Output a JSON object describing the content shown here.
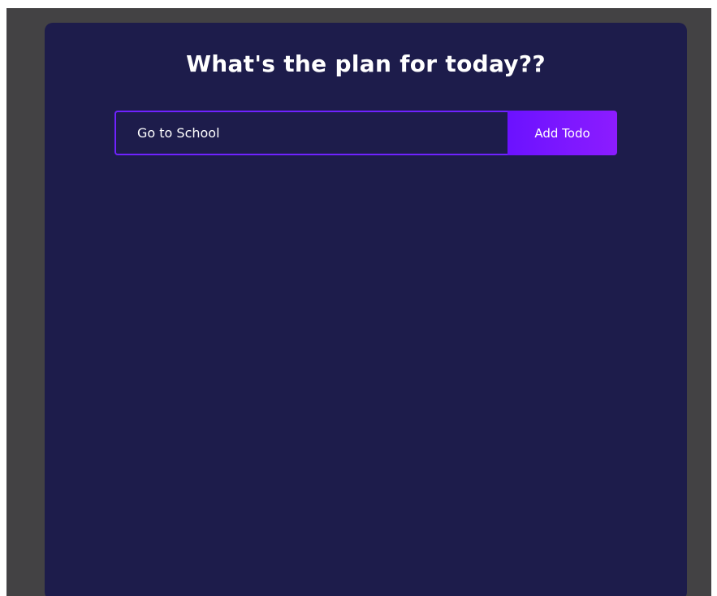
{
  "app": {
    "title": "What's the plan for today??"
  },
  "form": {
    "input_value": "Go to School",
    "button_label": "Add Todo"
  },
  "colors": {
    "outer_background": "#434244",
    "panel_background": "#1d1c4b",
    "accent": "#6f22ff",
    "text": "#ffffff"
  }
}
